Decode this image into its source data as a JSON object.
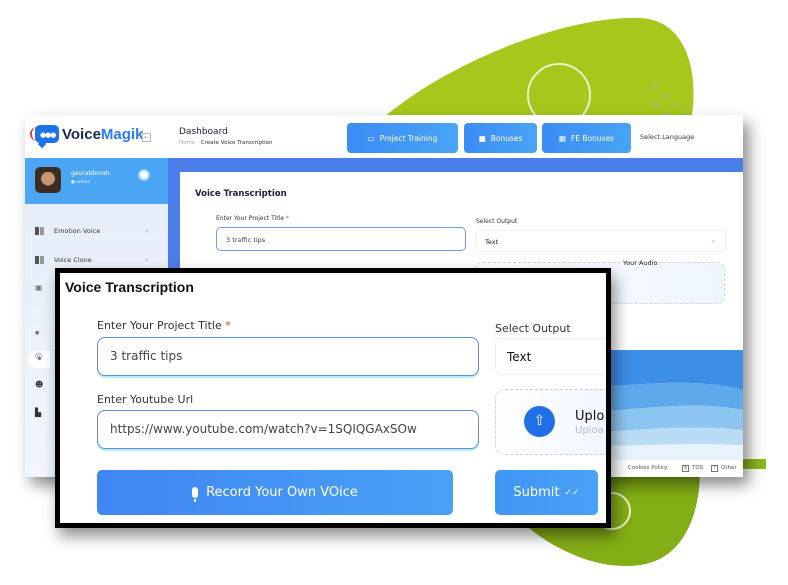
{
  "app": {
    "logo": {
      "part1": "Voice",
      "part2": "Magik"
    },
    "header": {
      "title": "Dashboard",
      "breadcrumb": {
        "home": "Home",
        "separator": "-",
        "current": "Create Voice Transcription"
      },
      "buttons": [
        {
          "label": "Project Training",
          "icon": "presentation-icon"
        },
        {
          "label": "Bonuses",
          "icon": "gift-icon"
        },
        {
          "label": "FE Bonuses",
          "icon": "gifts-icon"
        }
      ],
      "language_label": "Select Language"
    },
    "sidebar": {
      "user": {
        "name": "gaurabborah",
        "status": "online"
      },
      "items": [
        {
          "label": "Emotion Voice",
          "chevron": "›"
        },
        {
          "label": "Voice Clone",
          "chevron": "›"
        }
      ]
    },
    "form": {
      "title": "Voice Transcription",
      "project_title_label": "Enter Your Project Title",
      "required_mark": "*",
      "project_title_value": "3 traffic tips",
      "output_label": "Select Output",
      "output_value": "Text",
      "upload_text": "Your Audio"
    },
    "footer": {
      "links": [
        "Cookies Policy",
        "TOS",
        "Other"
      ]
    }
  },
  "zoom": {
    "title": "Voice Transcription",
    "project_title_label": "Enter Your Project Title",
    "required_mark": "*",
    "project_title_value": "3 traffic tips",
    "youtube_label": "Enter Youtube Url",
    "youtube_value": "https://www.youtube.com/watch?v=1SQIQGAxSOw",
    "output_label": "Select Output",
    "output_value": "Text",
    "upload_title": "Uplo",
    "upload_subtitle": "Uploa",
    "record_label": "Record Your Own VOice",
    "submit_label": "Submit",
    "submit_icon": "✓✓"
  },
  "colors": {
    "brand_blue": "#3f86f2",
    "accent_green": "#9bc31a",
    "required_red": "#e3443a"
  }
}
